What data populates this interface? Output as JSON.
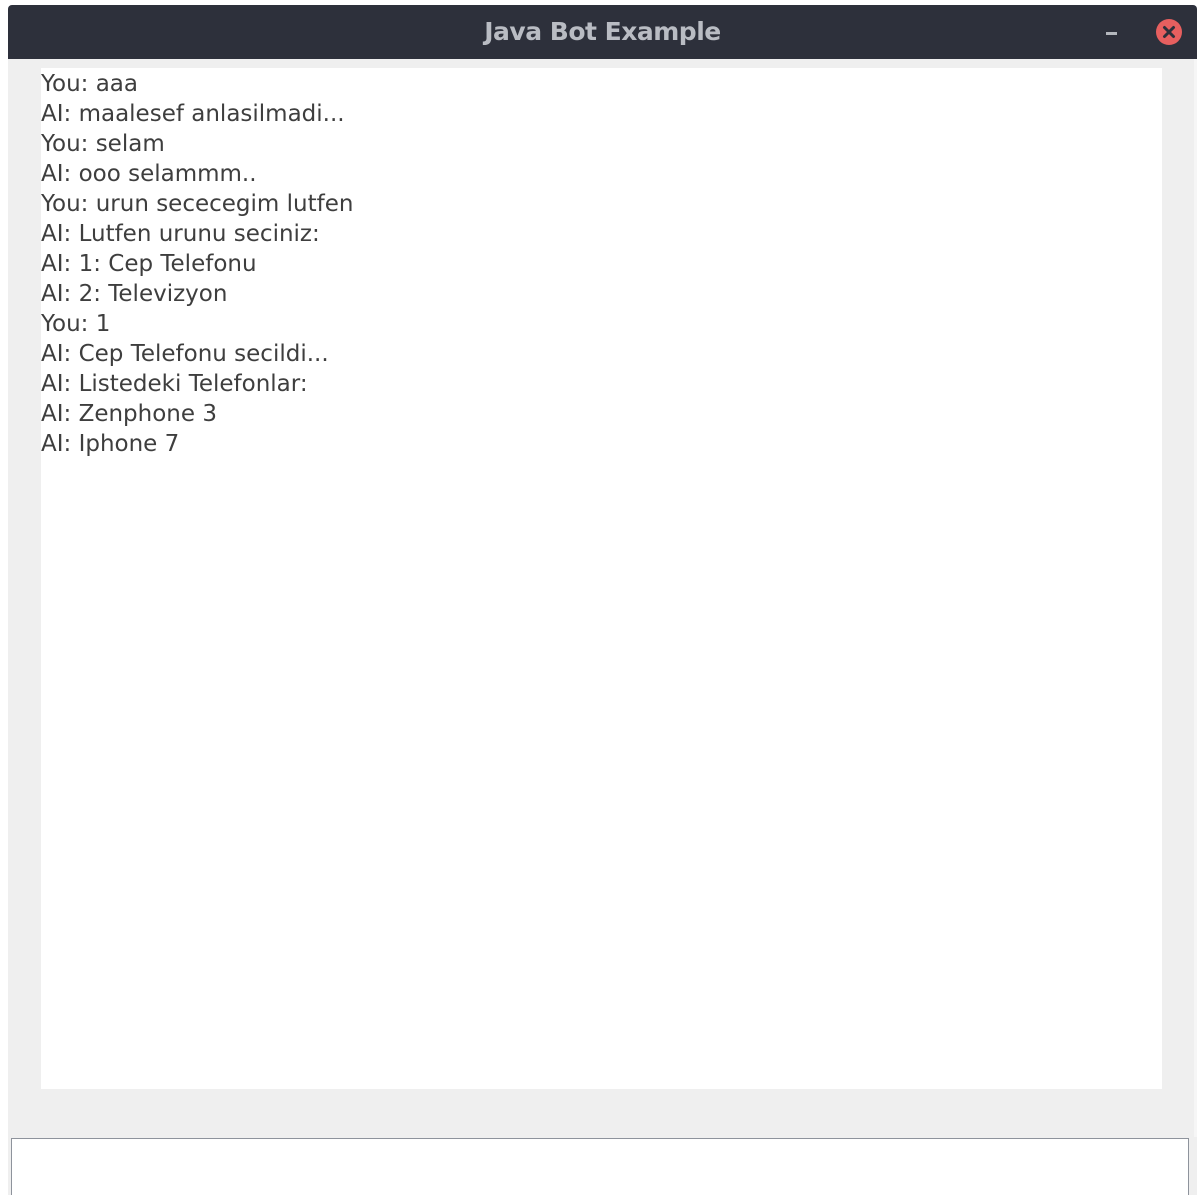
{
  "window": {
    "title": "Java Bot Example",
    "minimize_icon": "minimize-icon",
    "close_icon": "close-icon",
    "close_color": "#e75f5f"
  },
  "chat": {
    "lines": [
      "You: aaa",
      "AI: maalesef anlasilmadi...",
      "You: selam",
      "AI: ooo selammm..",
      "You: urun sececegim lutfen",
      "AI: Lutfen urunu seciniz:",
      "AI: 1: Cep Telefonu",
      "AI: 2: Televizyon",
      "You: 1",
      "AI: Cep Telefonu secildi...",
      "AI: Listedeki Telefonlar:",
      "AI: Zenphone 3",
      "AI: Iphone 7"
    ]
  },
  "input": {
    "value": "",
    "placeholder": ""
  }
}
